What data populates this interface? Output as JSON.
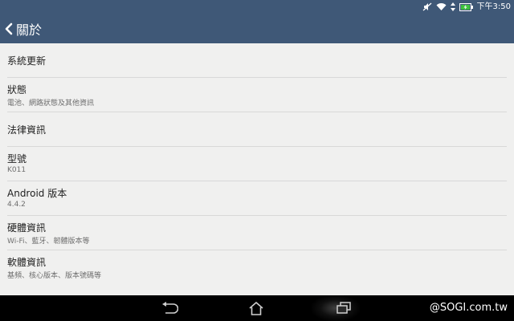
{
  "status_bar": {
    "time": "下午3:50",
    "icons": [
      "mute-icon",
      "wifi-icon",
      "data-arrows-icon",
      "battery-charging-icon"
    ]
  },
  "action_bar": {
    "back_icon": "chevron-left-icon",
    "title": "關於"
  },
  "settings": {
    "items": [
      {
        "title": "系統更新",
        "subtitle": ""
      },
      {
        "title": "狀態",
        "subtitle": "電池、網路狀態及其他資訊"
      },
      {
        "title": "法律資訊",
        "subtitle": ""
      },
      {
        "title": "型號",
        "subtitle": "K011"
      },
      {
        "title": "Android 版本",
        "subtitle": "4.4.2"
      },
      {
        "title": "硬體資訊",
        "subtitle": "Wi-Fi、藍牙、韌體版本等"
      },
      {
        "title": "軟體資訊",
        "subtitle": "基頻、核心版本、版本號碼等"
      }
    ]
  },
  "nav_bar": {
    "buttons": [
      "back-icon",
      "home-icon",
      "recents-icon"
    ],
    "watermark": "@SOGI.com.tw"
  },
  "colors": {
    "header": "#3f5877",
    "background": "#f0f0ef",
    "nav": "#000000"
  }
}
